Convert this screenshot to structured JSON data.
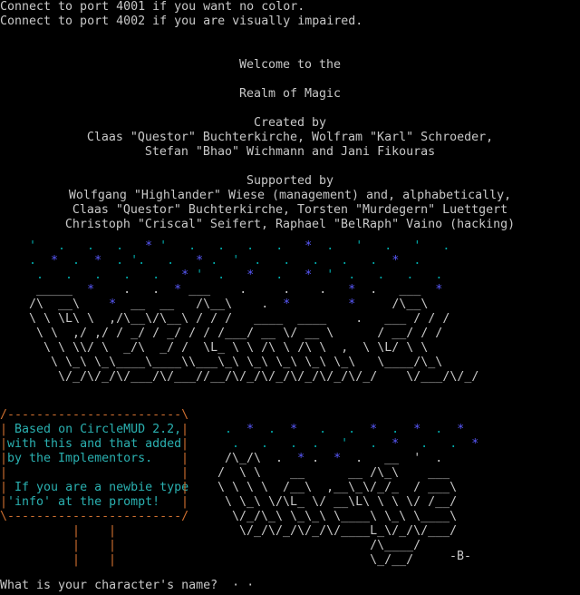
{
  "header": {
    "port_nocolor": "Connect to port 4001 if you want no color.",
    "port_impaired": "Connect to port 4002 if you are visually impaired."
  },
  "welcome": {
    "line1": "Welcome to the",
    "line2": "Realm of Magic"
  },
  "credits": {
    "created_title": "Created by",
    "created_line1": "Claas \"Questor\" Buchterkirche, Wolfram \"Karl\" Schroeder,",
    "created_line2": "Stefan \"Bhao\" Wichmann and Jani Fikouras",
    "supported_title": "Supported by",
    "supported_line1": "Wolfgang \"Highlander\" Wiese (management) and, alphabetically,",
    "supported_line2": "Claas \"Questor\" Buchterkirche, Torsten \"Murdegern\" Luettgert",
    "supported_line3": "Christoph \"Criscal\" Seifert, Raphael \"BelRaph\" Vaino (hacking)"
  },
  "info_box": {
    "line1": "Based on CircleMUD 2.2,",
    "line2": "with this and that added",
    "line3": "by the Implementors.",
    "line4": "If you are a newbie type",
    "line5": "'info' at the prompt!"
  },
  "signature": "-B-",
  "prompt": {
    "text": "What is your character's name?"
  },
  "colors": {
    "text": "#c8c8c8",
    "stars_cyan": "#00aaaa",
    "stars_blue": "#5a5aff",
    "box_border": "#d07030",
    "box_text": "#2ab0b0",
    "background": "#000000"
  }
}
